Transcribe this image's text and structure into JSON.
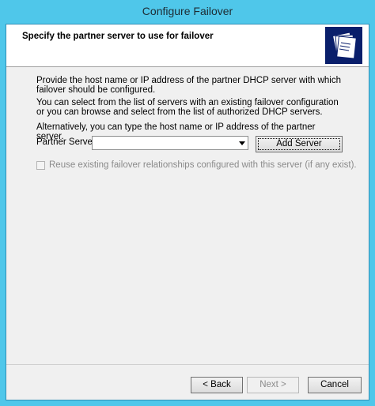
{
  "window": {
    "title": "Configure Failover"
  },
  "header": {
    "title": "Specify the partner server to use for failover",
    "icon": "folders-icon"
  },
  "body": {
    "paragraph1": "Provide the host name or IP address of the partner DHCP server with which failover should be configured.",
    "paragraph2": "You can select from the list of servers with an existing failover configuration or you can browse and select from the list of authorized DHCP servers.",
    "paragraph3": "Alternatively, you can type the host name or IP address of the partner server."
  },
  "partner": {
    "label": "Partner Server:",
    "value": ""
  },
  "buttons": {
    "add_server": "Add Server",
    "back": "< Back",
    "next": "Next >",
    "cancel": "Cancel"
  },
  "reuse_checkbox": {
    "label": "Reuse existing failover relationships configured with this server (if any exist).",
    "checked": false,
    "enabled": false
  },
  "colors": {
    "window_frame": "#4fc7ea",
    "header_icon_bg": "#0a1f6b"
  }
}
